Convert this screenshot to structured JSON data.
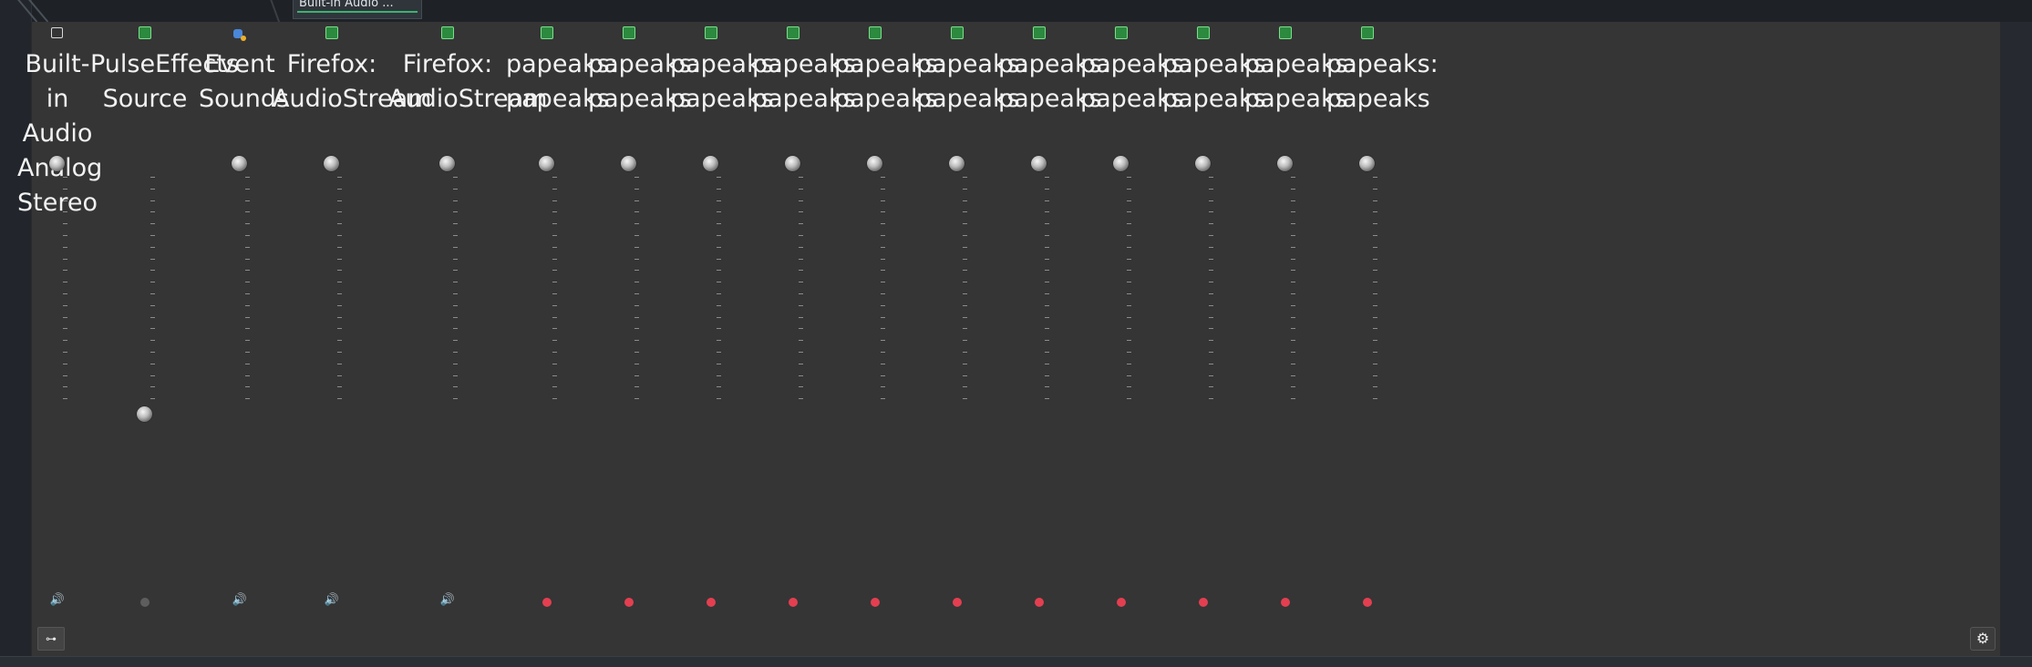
{
  "top_window": {
    "label": "Built-in Audio ..."
  },
  "strips": [
    {
      "name": "Built-\nin\nAudio\nAnalog\nStereo",
      "icon": "sink-icon",
      "control": "speaker"
    },
    {
      "name": "PulseEffects\nSource",
      "icon": "pulseeffects-icon",
      "control": "grey-dot",
      "level_fraction": 0.0
    },
    {
      "name": "Event\nSounds",
      "icon": "event-sounds-icon",
      "control": "speaker"
    },
    {
      "name": "Firefox:\nAudioStream",
      "icon": "pulseeffects-icon",
      "control": "speaker"
    },
    {
      "name": "Firefox:\nAudioStream",
      "icon": "pulseeffects-icon",
      "control": "speaker"
    },
    {
      "name": "papeaks:\npapeaks",
      "icon": "pulseeffects-icon",
      "control": "red-dot"
    },
    {
      "name": "papeaks:\npapeaks",
      "icon": "pulseeffects-icon",
      "control": "red-dot"
    },
    {
      "name": "papeaks:\npapeaks",
      "icon": "pulseeffects-icon",
      "control": "red-dot"
    },
    {
      "name": "papeaks:\npapeaks",
      "icon": "pulseeffects-icon",
      "control": "red-dot"
    },
    {
      "name": "papeaks:\npapeaks",
      "icon": "pulseeffects-icon",
      "control": "red-dot"
    },
    {
      "name": "papeaks:\npapeaks",
      "icon": "pulseeffects-icon",
      "control": "red-dot"
    },
    {
      "name": "papeaks:\npapeaks",
      "icon": "pulseeffects-icon",
      "control": "red-dot"
    },
    {
      "name": "papeaks:\npapeaks",
      "icon": "pulseeffects-icon",
      "control": "red-dot"
    },
    {
      "name": "papeaks:\npapeaks",
      "icon": "pulseeffects-icon",
      "control": "red-dot"
    },
    {
      "name": "papeaks:\npapeaks",
      "icon": "pulseeffects-icon",
      "control": "red-dot"
    },
    {
      "name": "papeaks:\npapeaks",
      "icon": "pulseeffects-icon",
      "control": "red-dot"
    }
  ],
  "colors": {
    "mute_active": "#e33f51",
    "mixer_bg": "#353535"
  },
  "bottom": {
    "left_button": "settings-tree-icon",
    "right_button": "gear-icon"
  }
}
